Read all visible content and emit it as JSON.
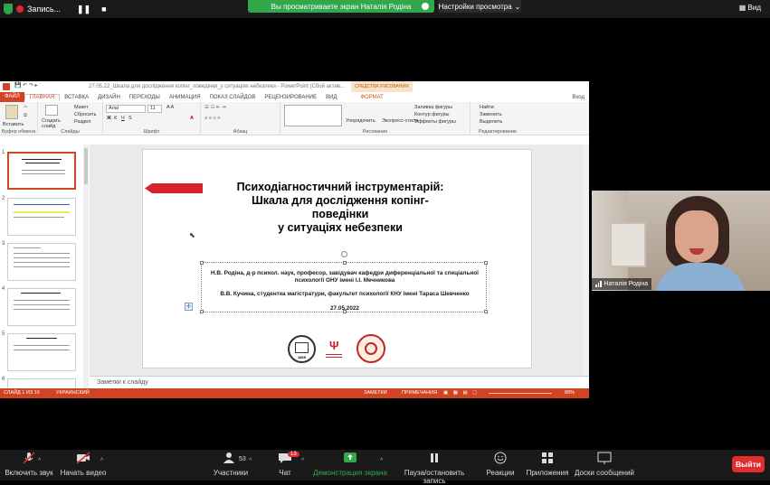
{
  "top": {
    "recording_label": "Запись...",
    "share_banner": "Вы просматриваете экран Наталія Родіна",
    "view_settings": "Настройки просмотра",
    "view_menu": "Вид"
  },
  "ppt": {
    "title": "27.05.22_Шкала для дослідження копінг_поведінки_у ситуаціях небезпеки - PowerPoint (Сбой актив...",
    "drawing_tools": "СРЕДСТВА РИСОВАНИЯ",
    "tabs": [
      "ФАЙЛ",
      "ГЛАВНАЯ",
      "ВСТАВКА",
      "ДИЗАЙН",
      "ПЕРЕХОДЫ",
      "АНИМАЦИЯ",
      "ПОКАЗ СЛАЙДОВ",
      "РЕЦЕНЗИРОВАНИЕ",
      "ВИД",
      "ФОРМАТ"
    ],
    "vid_label": "Вход",
    "ribbon": {
      "paste": "Вставить",
      "create_slide": "Создать слайд",
      "layout": "Макет",
      "reset": "Сбросить",
      "section": "Раздел",
      "font_name": "Arial",
      "font_size": "11",
      "group_clipboard": "Буфер обмена",
      "group_slides": "Слайды",
      "group_font": "Шрифт",
      "group_paragraph": "Абзац",
      "group_drawing": "Рисование",
      "group_edit": "Редактирование",
      "arrange": "Упорядочить",
      "quick_styles": "Экспресс-стили",
      "shape_fill": "Заливка фигуры",
      "shape_outline": "Контур фигуры",
      "shape_effects": "Эффекты фигуры",
      "find": "Найти",
      "replace": "Заменить",
      "select": "Выделить"
    },
    "slide_numbers": [
      "1",
      "2",
      "3",
      "4",
      "5",
      "6"
    ],
    "slide": {
      "title_lines": [
        "Психодіагностичний інструментарій:",
        "Шкала для дослідження копінг-",
        "поведінки",
        "у ситуаціях небезпеки"
      ],
      "author1": "Н.В. Родіна, д-р психол. наук, професор, завідувач кафедри диференціальної та спеціальної",
      "author1b": "психології ОНУ імені І.І. Мечникова",
      "author2": "В.В. Кучина, студентка магістратури, факультет психології КНУ імені Тараса Шевченко",
      "date": "27.05.2022",
      "logo1_year": "1865"
    },
    "notes": "Заметки к слайду",
    "status": {
      "slide": "СЛАЙД 1 ИЗ 16",
      "lang": "УКРАИНСКИЙ",
      "notes": "ЗАМЕТКИ",
      "comments": "ПРИМЕЧАНИЯ",
      "zoom": "89%"
    }
  },
  "video": {
    "name": "Наталія Родіна"
  },
  "toolbar": {
    "mute": "Включить звук",
    "video": "Начать видео",
    "participants": "Участники",
    "participants_count": "53",
    "chat": "Чат",
    "chat_count": "13",
    "share": "Демонстрация экрана",
    "record": "Пауза/остановить запись",
    "reactions": "Реакции",
    "apps": "Приложения",
    "whiteboards": "Доски сообщений",
    "end": "Выйти"
  },
  "colors": {
    "ppt_accent": "#d04423",
    "share_green": "#30a84b",
    "end_red": "#e22d2d"
  }
}
